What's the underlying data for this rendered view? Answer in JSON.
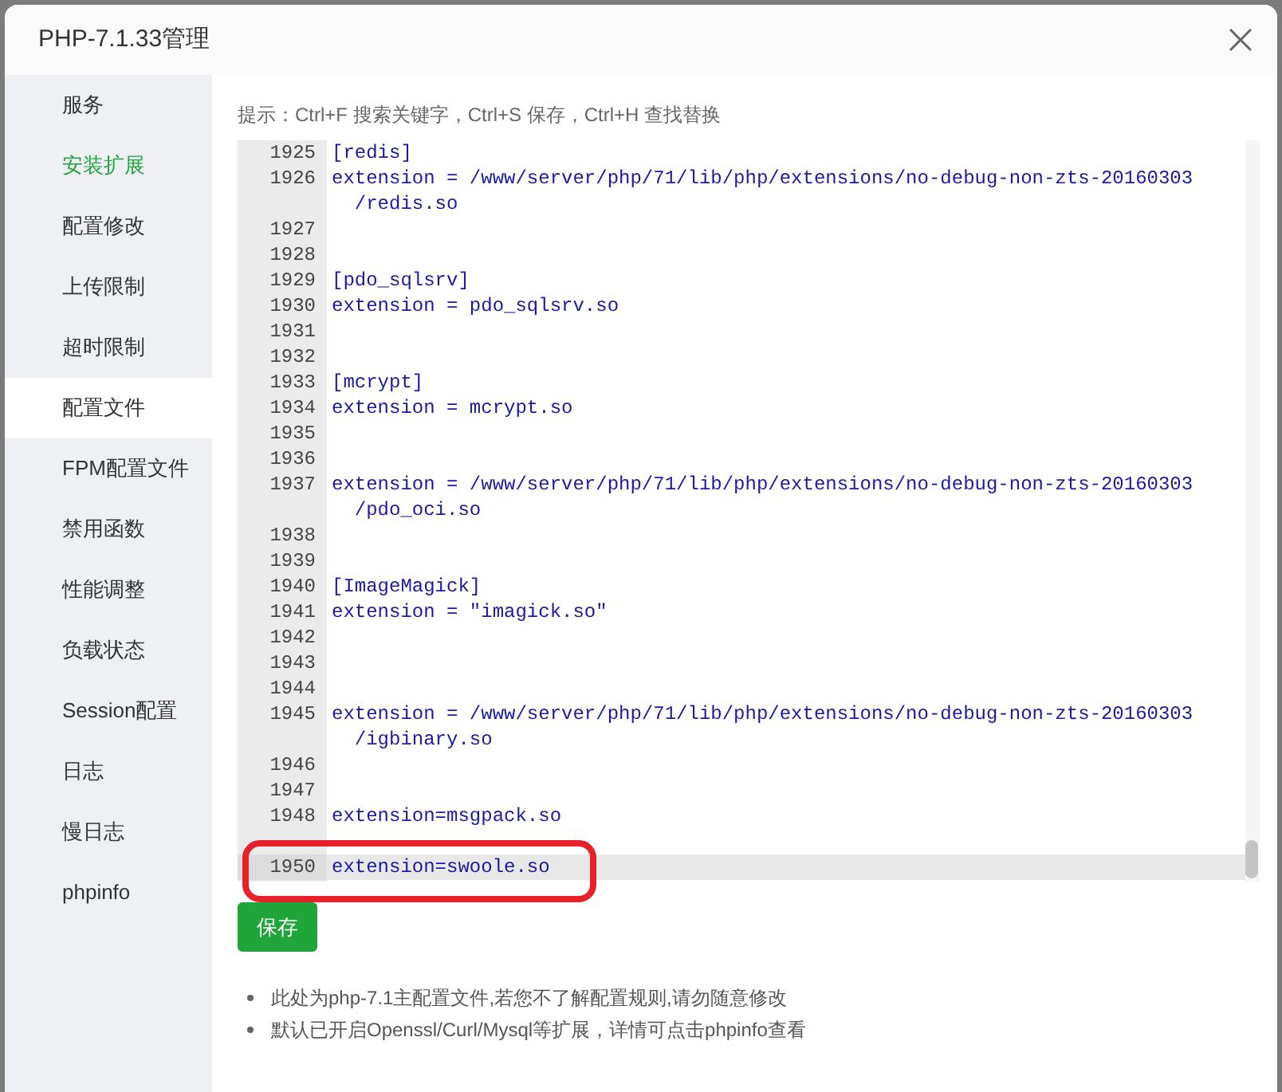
{
  "window": {
    "title": "PHP-7.1.33管理"
  },
  "sidebar": {
    "items": [
      {
        "label": "服务",
        "selected": false,
        "hovered": false
      },
      {
        "label": "安装扩展",
        "selected": false,
        "hovered": true
      },
      {
        "label": "配置修改",
        "selected": false,
        "hovered": false
      },
      {
        "label": "上传限制",
        "selected": false,
        "hovered": false
      },
      {
        "label": "超时限制",
        "selected": false,
        "hovered": false
      },
      {
        "label": "配置文件",
        "selected": true,
        "hovered": false
      },
      {
        "label": "FPM配置文件",
        "selected": false,
        "hovered": false
      },
      {
        "label": "禁用函数",
        "selected": false,
        "hovered": false
      },
      {
        "label": "性能调整",
        "selected": false,
        "hovered": false
      },
      {
        "label": "负载状态",
        "selected": false,
        "hovered": false
      },
      {
        "label": "Session配置",
        "selected": false,
        "hovered": false
      },
      {
        "label": "日志",
        "selected": false,
        "hovered": false
      },
      {
        "label": "慢日志",
        "selected": false,
        "hovered": false
      },
      {
        "label": "phpinfo",
        "selected": false,
        "hovered": false
      }
    ]
  },
  "hint": "提示：Ctrl+F 搜索关键字，Ctrl+S 保存，Ctrl+H 查找替换",
  "editor": {
    "lines": [
      {
        "number": "1925",
        "rows": [
          "[redis]"
        ],
        "active": false,
        "circled": false
      },
      {
        "number": "1926",
        "rows": [
          "extension = /www/server/php/71/lib/php/extensions/no-debug-non-zts-20160303",
          "/redis.so"
        ],
        "active": false,
        "circled": false
      },
      {
        "number": "1927",
        "active": false,
        "circled": false
      },
      {
        "number": "1928",
        "active": false,
        "circled": false
      },
      {
        "number": "1929",
        "rows": [
          "[pdo_sqlsrv]"
        ],
        "active": false,
        "circled": false
      },
      {
        "number": "1930",
        "rows": [
          "extension = pdo_sqlsrv.so"
        ],
        "active": false,
        "circled": false
      },
      {
        "number": "1931",
        "active": false,
        "circled": false
      },
      {
        "number": "1932",
        "active": false,
        "circled": false
      },
      {
        "number": "1933",
        "rows": [
          "[mcrypt]"
        ],
        "active": false,
        "circled": false
      },
      {
        "number": "1934",
        "rows": [
          "extension = mcrypt.so"
        ],
        "active": false,
        "circled": false
      },
      {
        "number": "1935",
        "active": false,
        "circled": false
      },
      {
        "number": "1936",
        "active": false,
        "circled": false
      },
      {
        "number": "1937",
        "rows": [
          "extension = /www/server/php/71/lib/php/extensions/no-debug-non-zts-20160303",
          "/pdo_oci.so"
        ],
        "active": false,
        "circled": false
      },
      {
        "number": "1938",
        "active": false,
        "circled": false
      },
      {
        "number": "1939",
        "active": false,
        "circled": false
      },
      {
        "number": "1940",
        "rows": [
          "[ImageMagick]"
        ],
        "active": false,
        "circled": false
      },
      {
        "number": "1941",
        "rows": [
          "extension = \"imagick.so\""
        ],
        "active": false,
        "circled": false
      },
      {
        "number": "1942",
        "active": false,
        "circled": false
      },
      {
        "number": "1943",
        "active": false,
        "circled": false
      },
      {
        "number": "1944",
        "active": false,
        "circled": false
      },
      {
        "number": "1945",
        "rows": [
          "extension = /www/server/php/71/lib/php/extensions/no-debug-non-zts-20160303",
          "/igbinary.so"
        ],
        "active": false,
        "circled": false
      },
      {
        "number": "1946",
        "active": false,
        "circled": false
      },
      {
        "number": "1947",
        "active": false,
        "circled": false
      },
      {
        "number": "1948",
        "rows": [
          "extension=msgpack.so"
        ],
        "active": false,
        "circled": false
      },
      {
        "active": false,
        "circled": false
      },
      {
        "number": "1950",
        "rows": [
          "extension=swoole.so"
        ],
        "active": true,
        "circled": true
      }
    ]
  },
  "save_button": "保存",
  "notes": [
    "此处为php-7.1主配置文件,若您不了解配置规则,请勿随意修改",
    "默认已开启Openssl/Curl/Mysql等扩展，详情可点击phpinfo查看"
  ]
}
